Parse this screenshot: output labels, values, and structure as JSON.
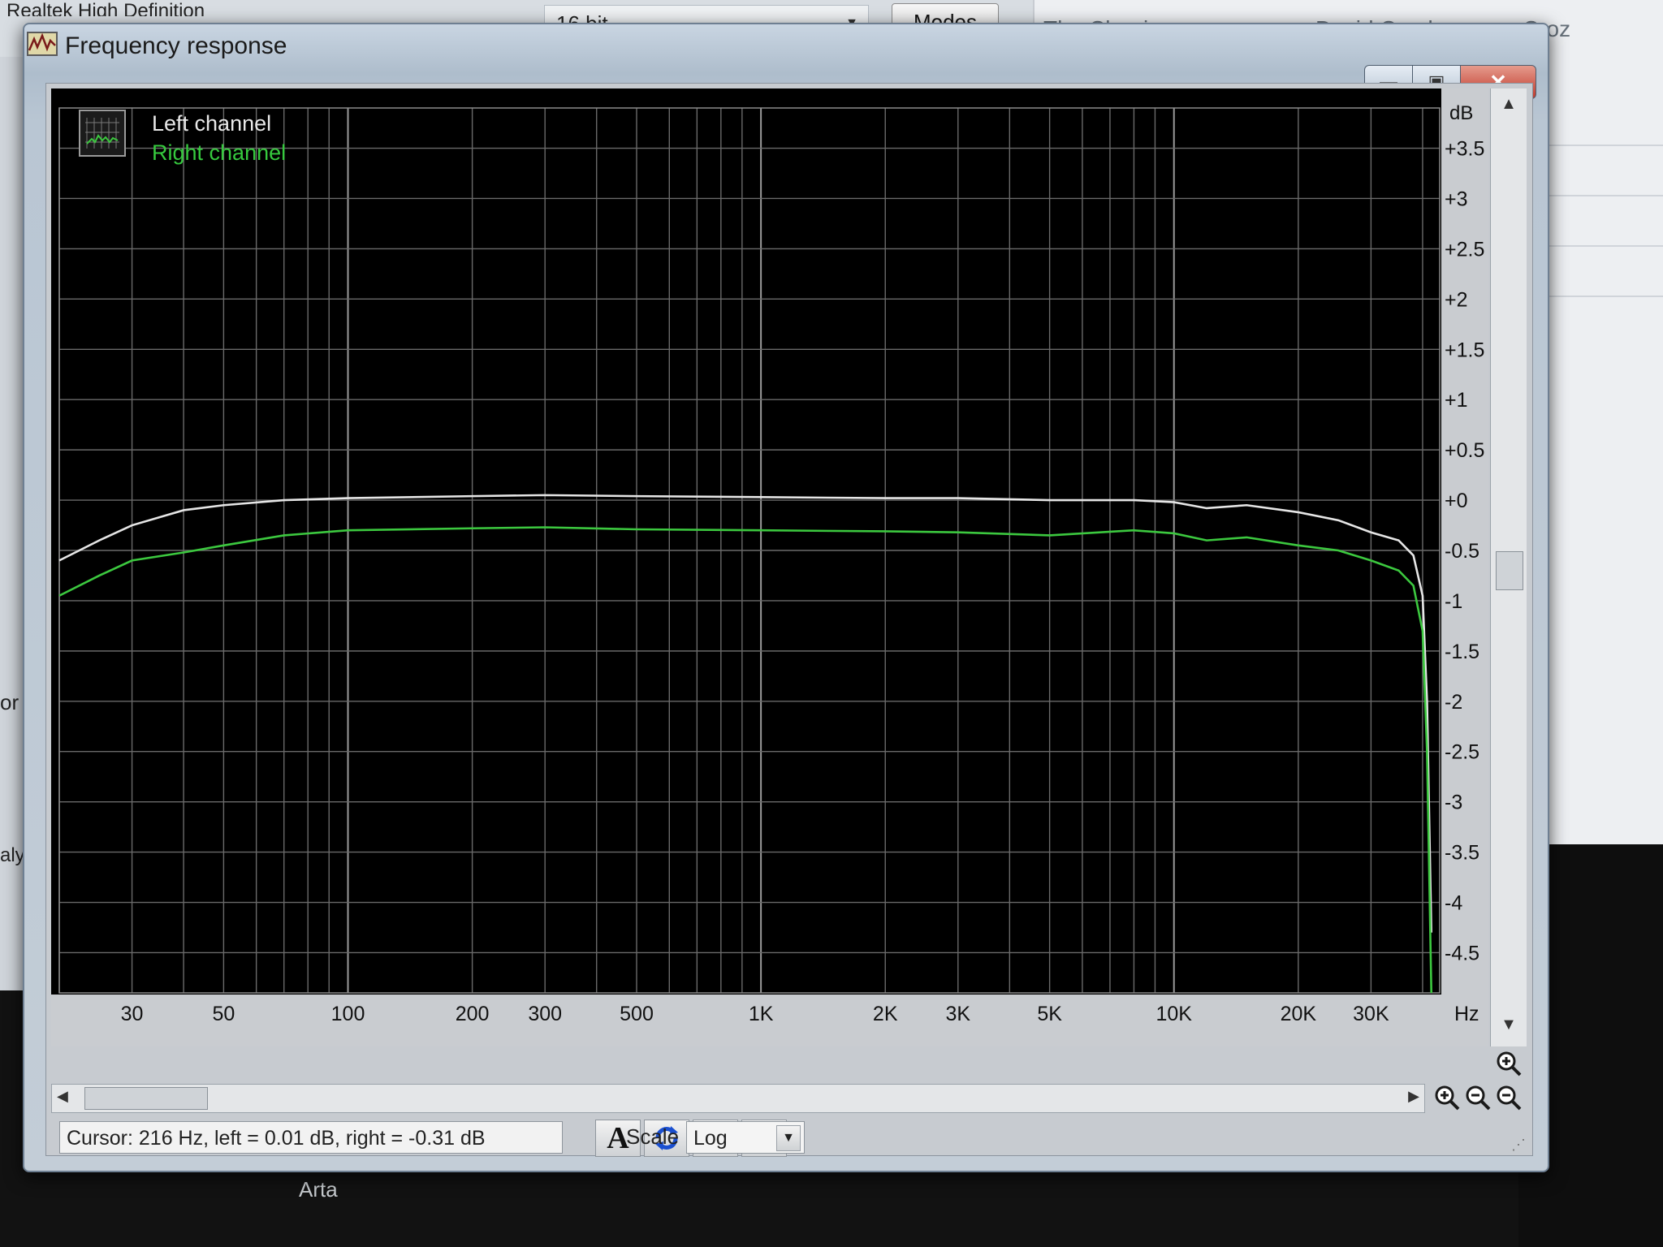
{
  "background": {
    "device_label": "Realtek High Definition",
    "bits_label": "16 bit",
    "modes_label": "Modes",
    "track_title": "The Clearing",
    "track_artist": "David Crosby",
    "track_album": "Croz",
    "left_text_1": "or",
    "left_text_2": "aly",
    "taskbar_label": "Arta"
  },
  "window": {
    "title": "Frequency response",
    "minimize_icon": "minimize-icon",
    "maximize_icon": "maximize-icon",
    "close_icon": "close-icon"
  },
  "legend": {
    "left_label": "Left channel",
    "right_label": "Right channel"
  },
  "status": {
    "cursor_text": "Cursor:  216 Hz,  left = 0.01 dB,  right = -0.31 dB",
    "scale_label": "Scale",
    "scale_value": "Log"
  },
  "chart_data": {
    "type": "line",
    "x_scale": "log",
    "xlim": [
      20,
      44000
    ],
    "ylim": [
      -4.9,
      3.9
    ],
    "grid": true,
    "legend_placement": "top-left",
    "ylabel_unit": "dB",
    "xlabel_unit": "Hz",
    "x_ticks": [
      {
        "v": 30,
        "label": "30"
      },
      {
        "v": 50,
        "label": "50"
      },
      {
        "v": 100,
        "label": "100"
      },
      {
        "v": 200,
        "label": "200"
      },
      {
        "v": 300,
        "label": "300"
      },
      {
        "v": 500,
        "label": "500"
      },
      {
        "v": 1000,
        "label": "1K"
      },
      {
        "v": 2000,
        "label": "2K"
      },
      {
        "v": 3000,
        "label": "3K"
      },
      {
        "v": 5000,
        "label": "5K"
      },
      {
        "v": 10000,
        "label": "10K"
      },
      {
        "v": 20000,
        "label": "20K"
      },
      {
        "v": 30000,
        "label": "30K"
      }
    ],
    "y_ticks": [
      {
        "v": 3.5,
        "label": "+3.5"
      },
      {
        "v": 3,
        "label": "+3"
      },
      {
        "v": 2.5,
        "label": "+2.5"
      },
      {
        "v": 2,
        "label": "+2"
      },
      {
        "v": 1.5,
        "label": "+1.5"
      },
      {
        "v": 1,
        "label": "+1"
      },
      {
        "v": 0.5,
        "label": "+0.5"
      },
      {
        "v": 0,
        "label": "+0"
      },
      {
        "v": -0.5,
        "label": "-0.5"
      },
      {
        "v": -1,
        "label": "-1"
      },
      {
        "v": -1.5,
        "label": "-1.5"
      },
      {
        "v": -2,
        "label": "-2"
      },
      {
        "v": -2.5,
        "label": "-2.5"
      },
      {
        "v": -3,
        "label": "-3"
      },
      {
        "v": -3.5,
        "label": "-3.5"
      },
      {
        "v": -4,
        "label": "-4"
      },
      {
        "v": -4.5,
        "label": "-4.5"
      }
    ],
    "series": [
      {
        "name": "Left channel",
        "color": "#e6e6e6",
        "points": [
          [
            20,
            -0.6
          ],
          [
            25,
            -0.4
          ],
          [
            30,
            -0.25
          ],
          [
            40,
            -0.1
          ],
          [
            50,
            -0.05
          ],
          [
            70,
            0.0
          ],
          [
            100,
            0.02
          ],
          [
            200,
            0.04
          ],
          [
            300,
            0.05
          ],
          [
            500,
            0.04
          ],
          [
            1000,
            0.03
          ],
          [
            2000,
            0.02
          ],
          [
            3000,
            0.02
          ],
          [
            5000,
            0.0
          ],
          [
            8000,
            0.0
          ],
          [
            10000,
            -0.02
          ],
          [
            12000,
            -0.08
          ],
          [
            15000,
            -0.05
          ],
          [
            20000,
            -0.12
          ],
          [
            25000,
            -0.2
          ],
          [
            30000,
            -0.32
          ],
          [
            35000,
            -0.4
          ],
          [
            38000,
            -0.55
          ],
          [
            40000,
            -0.95
          ],
          [
            41000,
            -2.0
          ],
          [
            42000,
            -4.3
          ]
        ]
      },
      {
        "name": "Right channel",
        "color": "#3cc83f",
        "points": [
          [
            20,
            -0.95
          ],
          [
            25,
            -0.75
          ],
          [
            30,
            -0.6
          ],
          [
            40,
            -0.52
          ],
          [
            50,
            -0.45
          ],
          [
            70,
            -0.35
          ],
          [
            100,
            -0.3
          ],
          [
            200,
            -0.28
          ],
          [
            300,
            -0.27
          ],
          [
            500,
            -0.29
          ],
          [
            1000,
            -0.3
          ],
          [
            2000,
            -0.31
          ],
          [
            3000,
            -0.32
          ],
          [
            5000,
            -0.35
          ],
          [
            8000,
            -0.3
          ],
          [
            10000,
            -0.33
          ],
          [
            12000,
            -0.4
          ],
          [
            15000,
            -0.37
          ],
          [
            20000,
            -0.45
          ],
          [
            25000,
            -0.5
          ],
          [
            30000,
            -0.6
          ],
          [
            35000,
            -0.7
          ],
          [
            38000,
            -0.85
          ],
          [
            40000,
            -1.3
          ],
          [
            41000,
            -2.5
          ],
          [
            42000,
            -4.9
          ]
        ]
      }
    ]
  }
}
